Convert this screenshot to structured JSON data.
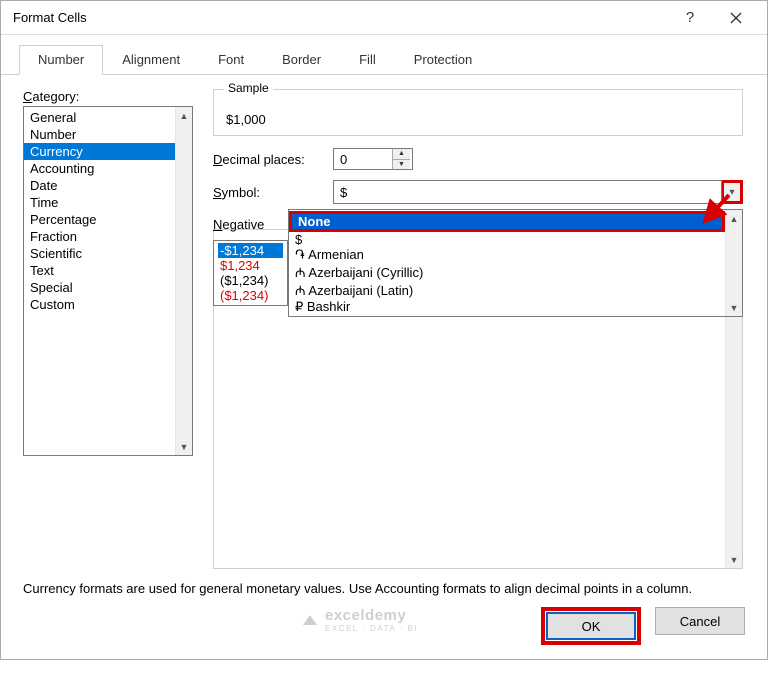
{
  "window": {
    "title": "Format Cells"
  },
  "tabs": [
    "Number",
    "Alignment",
    "Font",
    "Border",
    "Fill",
    "Protection"
  ],
  "active_tab": 0,
  "category": {
    "label": "Category:",
    "items": [
      "General",
      "Number",
      "Currency",
      "Accounting",
      "Date",
      "Time",
      "Percentage",
      "Fraction",
      "Scientific",
      "Text",
      "Special",
      "Custom"
    ],
    "selected_index": 2
  },
  "sample": {
    "legend": "Sample",
    "value": "$1,000"
  },
  "decimal": {
    "label": "Decimal places:",
    "value": "0"
  },
  "symbol": {
    "label": "Symbol:",
    "selected": "$"
  },
  "symbol_dropdown": {
    "items": [
      "None",
      "$",
      "֏ Armenian",
      "₼ Azerbaijani (Cyrillic)",
      "₼ Azerbaijani (Latin)",
      "₽ Bashkir"
    ],
    "selected_index": 0
  },
  "negative": {
    "label": "Negative",
    "items": [
      {
        "text": "-$1,234",
        "color": "sel"
      },
      {
        "text": "$1,234",
        "color": "red"
      },
      {
        "text": "($1,234)",
        "color": "black"
      },
      {
        "text": "($1,234)",
        "color": "red"
      }
    ]
  },
  "description": "Currency formats are used for general monetary values.  Use Accounting formats to align decimal points in a column.",
  "buttons": {
    "ok": "OK",
    "cancel": "Cancel"
  },
  "watermark": {
    "main": "exceldemy",
    "sub": "EXCEL · DATA · BI"
  }
}
